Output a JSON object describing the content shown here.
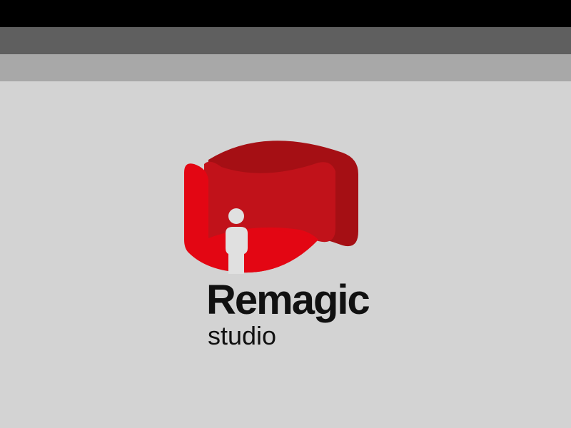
{
  "window": {
    "chrome_colors": {
      "top_bar": "#000000",
      "middle_bar": "#5f5f5f",
      "lower_bar": "#a8a8a8",
      "background": "#d3d3d3"
    }
  },
  "splash": {
    "logo_icon": "remagic-studio-logo-icon",
    "brand_name": "Remagic",
    "brand_subtitle": "studio",
    "colors": {
      "primary_red": "#e30613",
      "mid_red": "#c1121a",
      "dark_red": "#a50f14",
      "figure": "#e0e0e0",
      "text": "#111111"
    }
  }
}
